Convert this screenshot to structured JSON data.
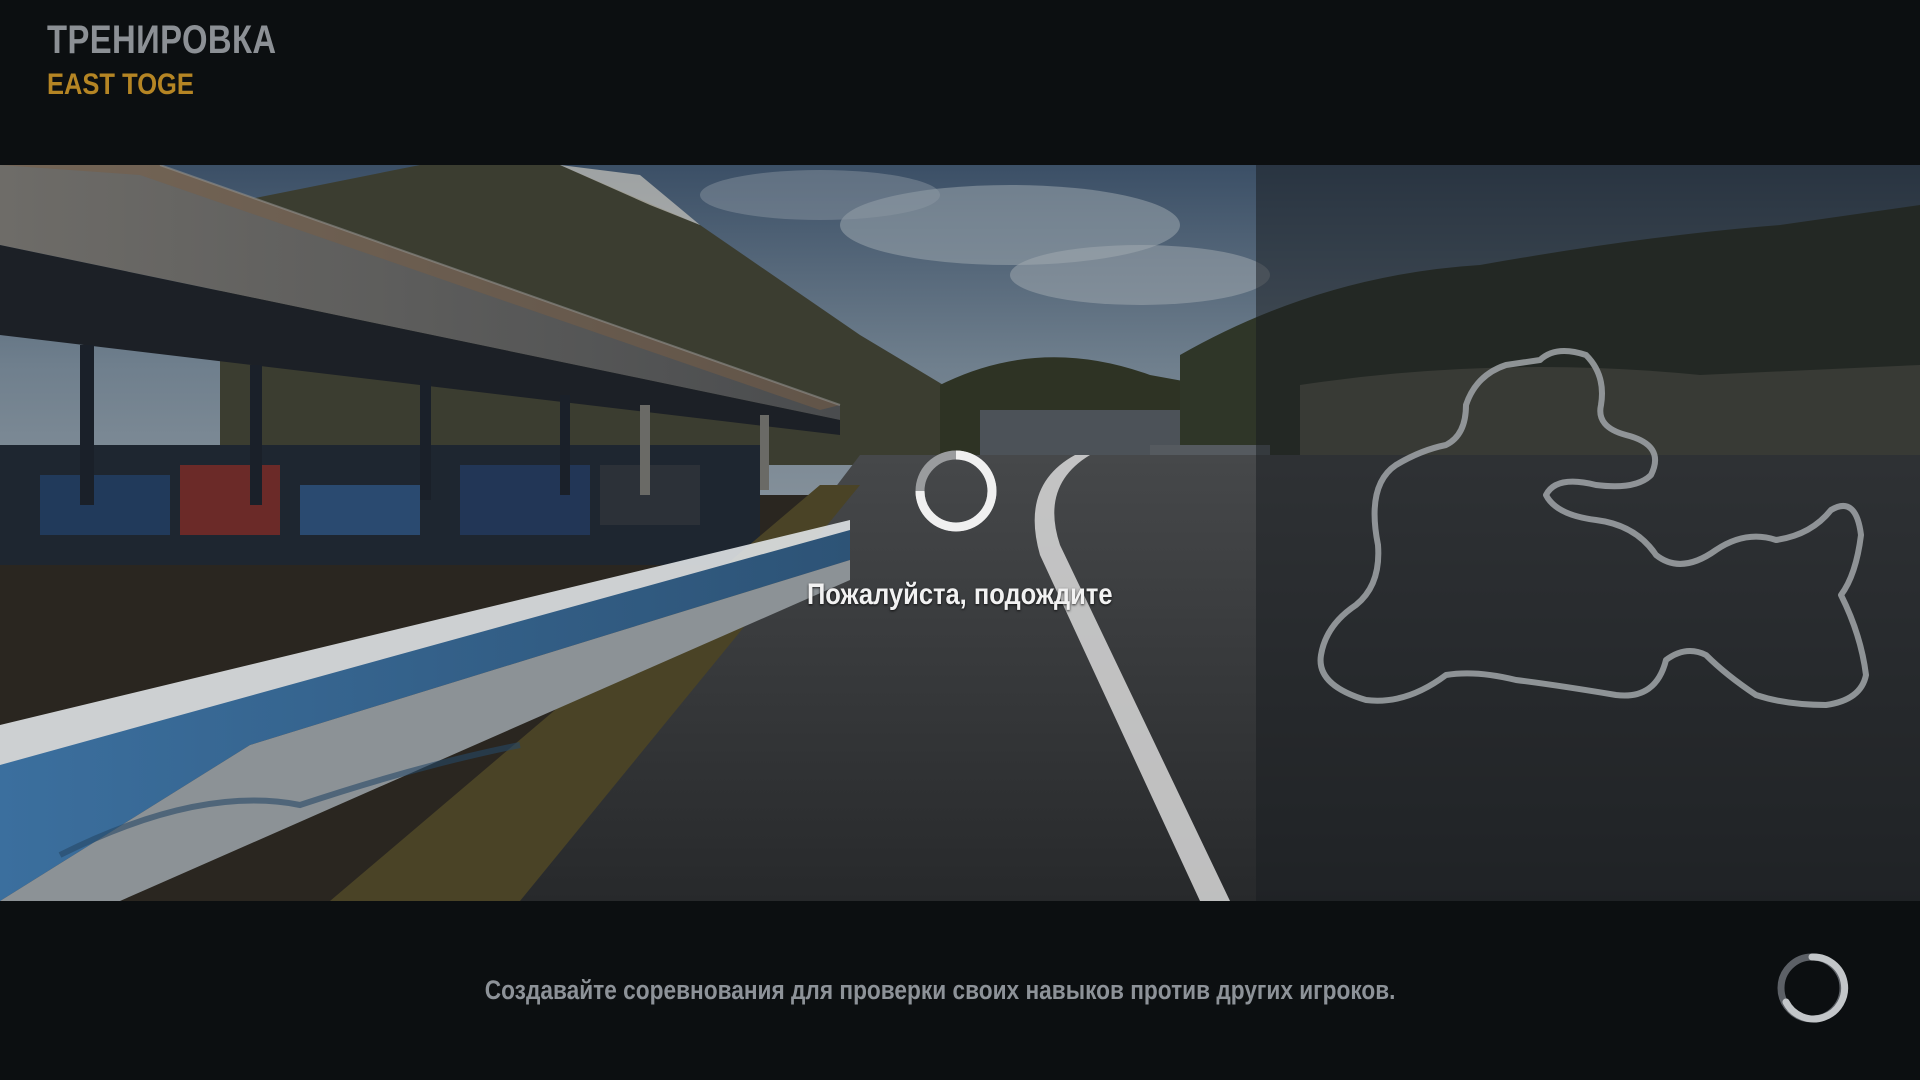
{
  "header": {
    "mode_title": "ТРЕНИРОВКА",
    "track_name": "EAST TOGE"
  },
  "loading": {
    "message": "Пожалуйста, подождите",
    "hint": "Создавайте соревнования для проверки своих навыков против других игроков."
  },
  "colors": {
    "background": "#0c0f11",
    "mode_title": "#8c9095",
    "track_name": "#b58524",
    "message": "#f2f2f2",
    "hint": "#8d9298",
    "track_outline": "#9a9ea2"
  },
  "icons": {
    "center_spinner": "loading-spinner-icon",
    "corner_spinner": "loading-ring-icon",
    "map": "track-map-icon"
  }
}
